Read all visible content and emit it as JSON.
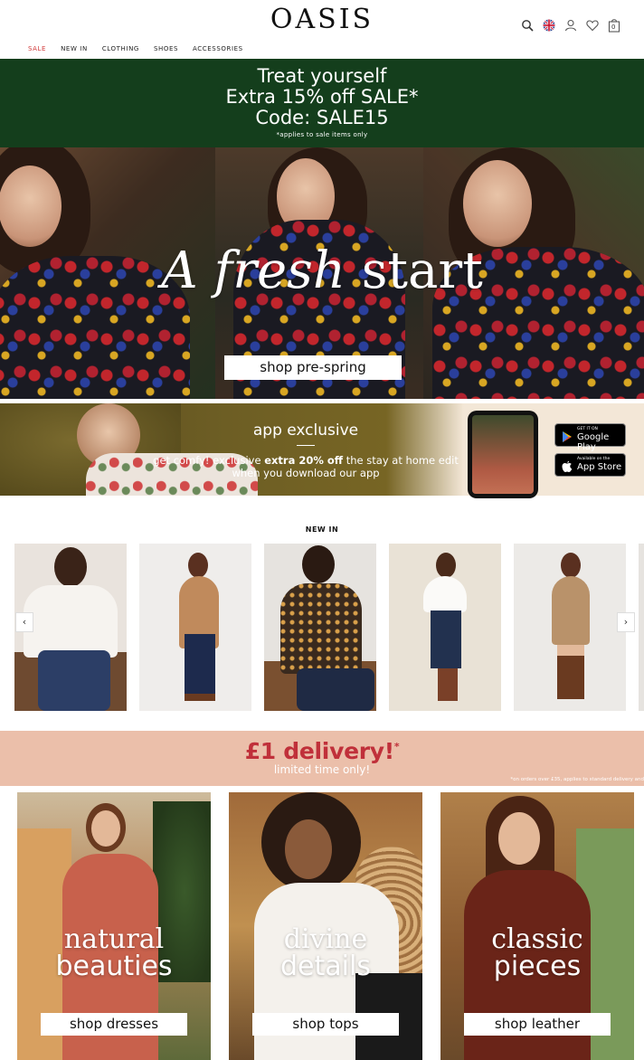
{
  "header": {
    "logo": "OASIS",
    "nav": [
      "SALE",
      "NEW IN",
      "CLOTHING",
      "SHOES",
      "ACCESSORIES"
    ],
    "bag_count": "0",
    "icons": [
      "search-icon",
      "uk-flag-icon",
      "account-icon",
      "wishlist-heart-icon",
      "bag-icon"
    ]
  },
  "promo": {
    "line1": "Treat yourself",
    "line2": "Extra 15% off SALE*",
    "line3": "Code: SALE15",
    "note": "*applies to sale items only",
    "bg": "#143e1c"
  },
  "hero": {
    "title_italic": "A fresh",
    "title_rest": "start",
    "cta": "shop pre-spring"
  },
  "app_banner": {
    "title": "app exclusive",
    "sub_pre": "get comfy! exclusive",
    "sub_bold": "extra 20% off",
    "sub_post": "the stay at home edit",
    "sub_line2": "when you download our app",
    "google_small": "GET IT ON",
    "google_big": "Google Play",
    "apple_small": "Available on the",
    "apple_big": "App Store"
  },
  "new_in": {
    "title": "NEW IN",
    "prev": "‹",
    "next": "›"
  },
  "delivery": {
    "headline": "£1 delivery!",
    "star": "*",
    "sub": "limited time only!",
    "note": "*on orders over £35, applies to standard delivery and"
  },
  "categories": [
    {
      "line1": "natural",
      "line2": "beauties",
      "cta": "shop dresses"
    },
    {
      "line1": "divine",
      "line2": "details",
      "cta": "shop tops"
    },
    {
      "line1": "classic",
      "line2": "pieces",
      "cta": "shop leather"
    }
  ]
}
